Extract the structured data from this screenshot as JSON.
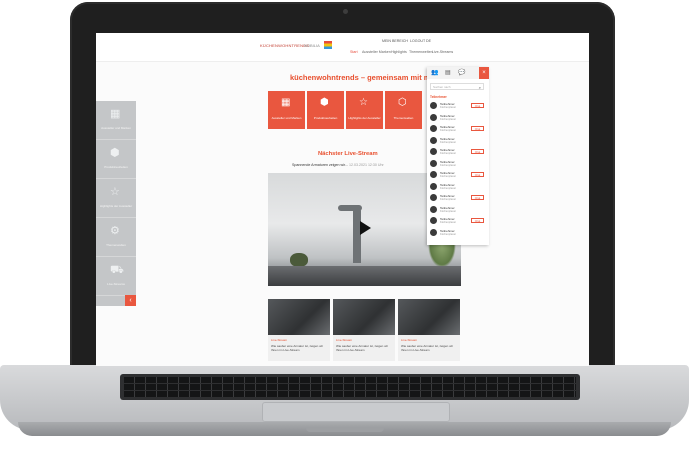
{
  "header": {
    "logo_text": "KÜCHENWOHNTRENDS",
    "logo_sub": "NOBILIA",
    "util_links": [
      "MEIN BEREICH",
      "LOGOUT",
      "DE"
    ],
    "nav": [
      "Start",
      "Aussteller Marken",
      "Highlights",
      "Themenwelten",
      "Live-Streams"
    ]
  },
  "main": {
    "headline": "küchenwohntrends – gemeinsam mit möbel aus",
    "tiles": [
      {
        "icon": "grid-icon",
        "glyph": "▦",
        "label": "Aussteller und Marken"
      },
      {
        "icon": "box-icon",
        "glyph": "⬢",
        "label": "Produktneuheiten"
      },
      {
        "icon": "star-icon",
        "glyph": "☆",
        "label": "Highlights der Aussteller"
      },
      {
        "icon": "cube-icon",
        "glyph": "⬡",
        "label": "Themenwelten"
      }
    ],
    "stream_title": "Nächster Live-Stream",
    "stream_subtitle": "Spannende Armaturen zeigen wir...",
    "stream_date": "12.03.2021 12:30 Uhr",
    "cards": [
      {
        "category": "Live-Stream",
        "text": "Wie sauber eine Armatur ist, zeigen wir Ihnen im Live-Stream"
      },
      {
        "category": "Live-Stream",
        "text": "Wie sauber eine Armatur ist, zeigen wir Ihnen im Live-Stream"
      },
      {
        "category": "Live-Stream",
        "text": "Wie sauber eine Armatur ist, zeigen wir Ihnen im Live-Stream"
      }
    ]
  },
  "sidebar": {
    "items": [
      {
        "icon": "grid-icon",
        "glyph": "▦",
        "label": "Aussteller und Marken"
      },
      {
        "icon": "box-icon",
        "glyph": "⬢",
        "label": "Produktneuheiten"
      },
      {
        "icon": "star-icon",
        "glyph": "☆",
        "label": "Highlights der Aussteller"
      },
      {
        "icon": "gear-icon",
        "glyph": "⚙",
        "label": "Themenwelten"
      },
      {
        "icon": "truck-icon",
        "glyph": "⛟",
        "label": "Live-Streams"
      }
    ],
    "toggle_glyph": "‹"
  },
  "right_panel": {
    "tabs": [
      "👥",
      "▤",
      "💬",
      "×"
    ],
    "search_placeholder": "Suchen nach",
    "section_header": "Teilnehmer",
    "contact_button": "Chat",
    "contacts": [
      {
        "name": "Teilnehmer",
        "sub": "Küchenplaner"
      },
      {
        "name": "Teilnehmer",
        "sub": "Küchenplaner"
      },
      {
        "name": "Teilnehmer",
        "sub": "Küchenplaner"
      },
      {
        "name": "Teilnehmer",
        "sub": "Küchenplaner"
      },
      {
        "name": "Teilnehmer",
        "sub": "Küchenplaner"
      },
      {
        "name": "Teilnehmer",
        "sub": "Küchenplaner"
      },
      {
        "name": "Teilnehmer",
        "sub": "Küchenplaner"
      },
      {
        "name": "Teilnehmer",
        "sub": "Küchenplaner"
      },
      {
        "name": "Teilnehmer",
        "sub": "Küchenplaner"
      },
      {
        "name": "Teilnehmer",
        "sub": "Küchenplaner"
      },
      {
        "name": "Teilnehmer",
        "sub": "Küchenplaner"
      },
      {
        "name": "Teilnehmer",
        "sub": "Küchenplaner"
      }
    ]
  },
  "colors": {
    "accent": "#e9573f",
    "sidebar": "#c4c6c8",
    "laptop_frame": "#1f1f1f"
  }
}
